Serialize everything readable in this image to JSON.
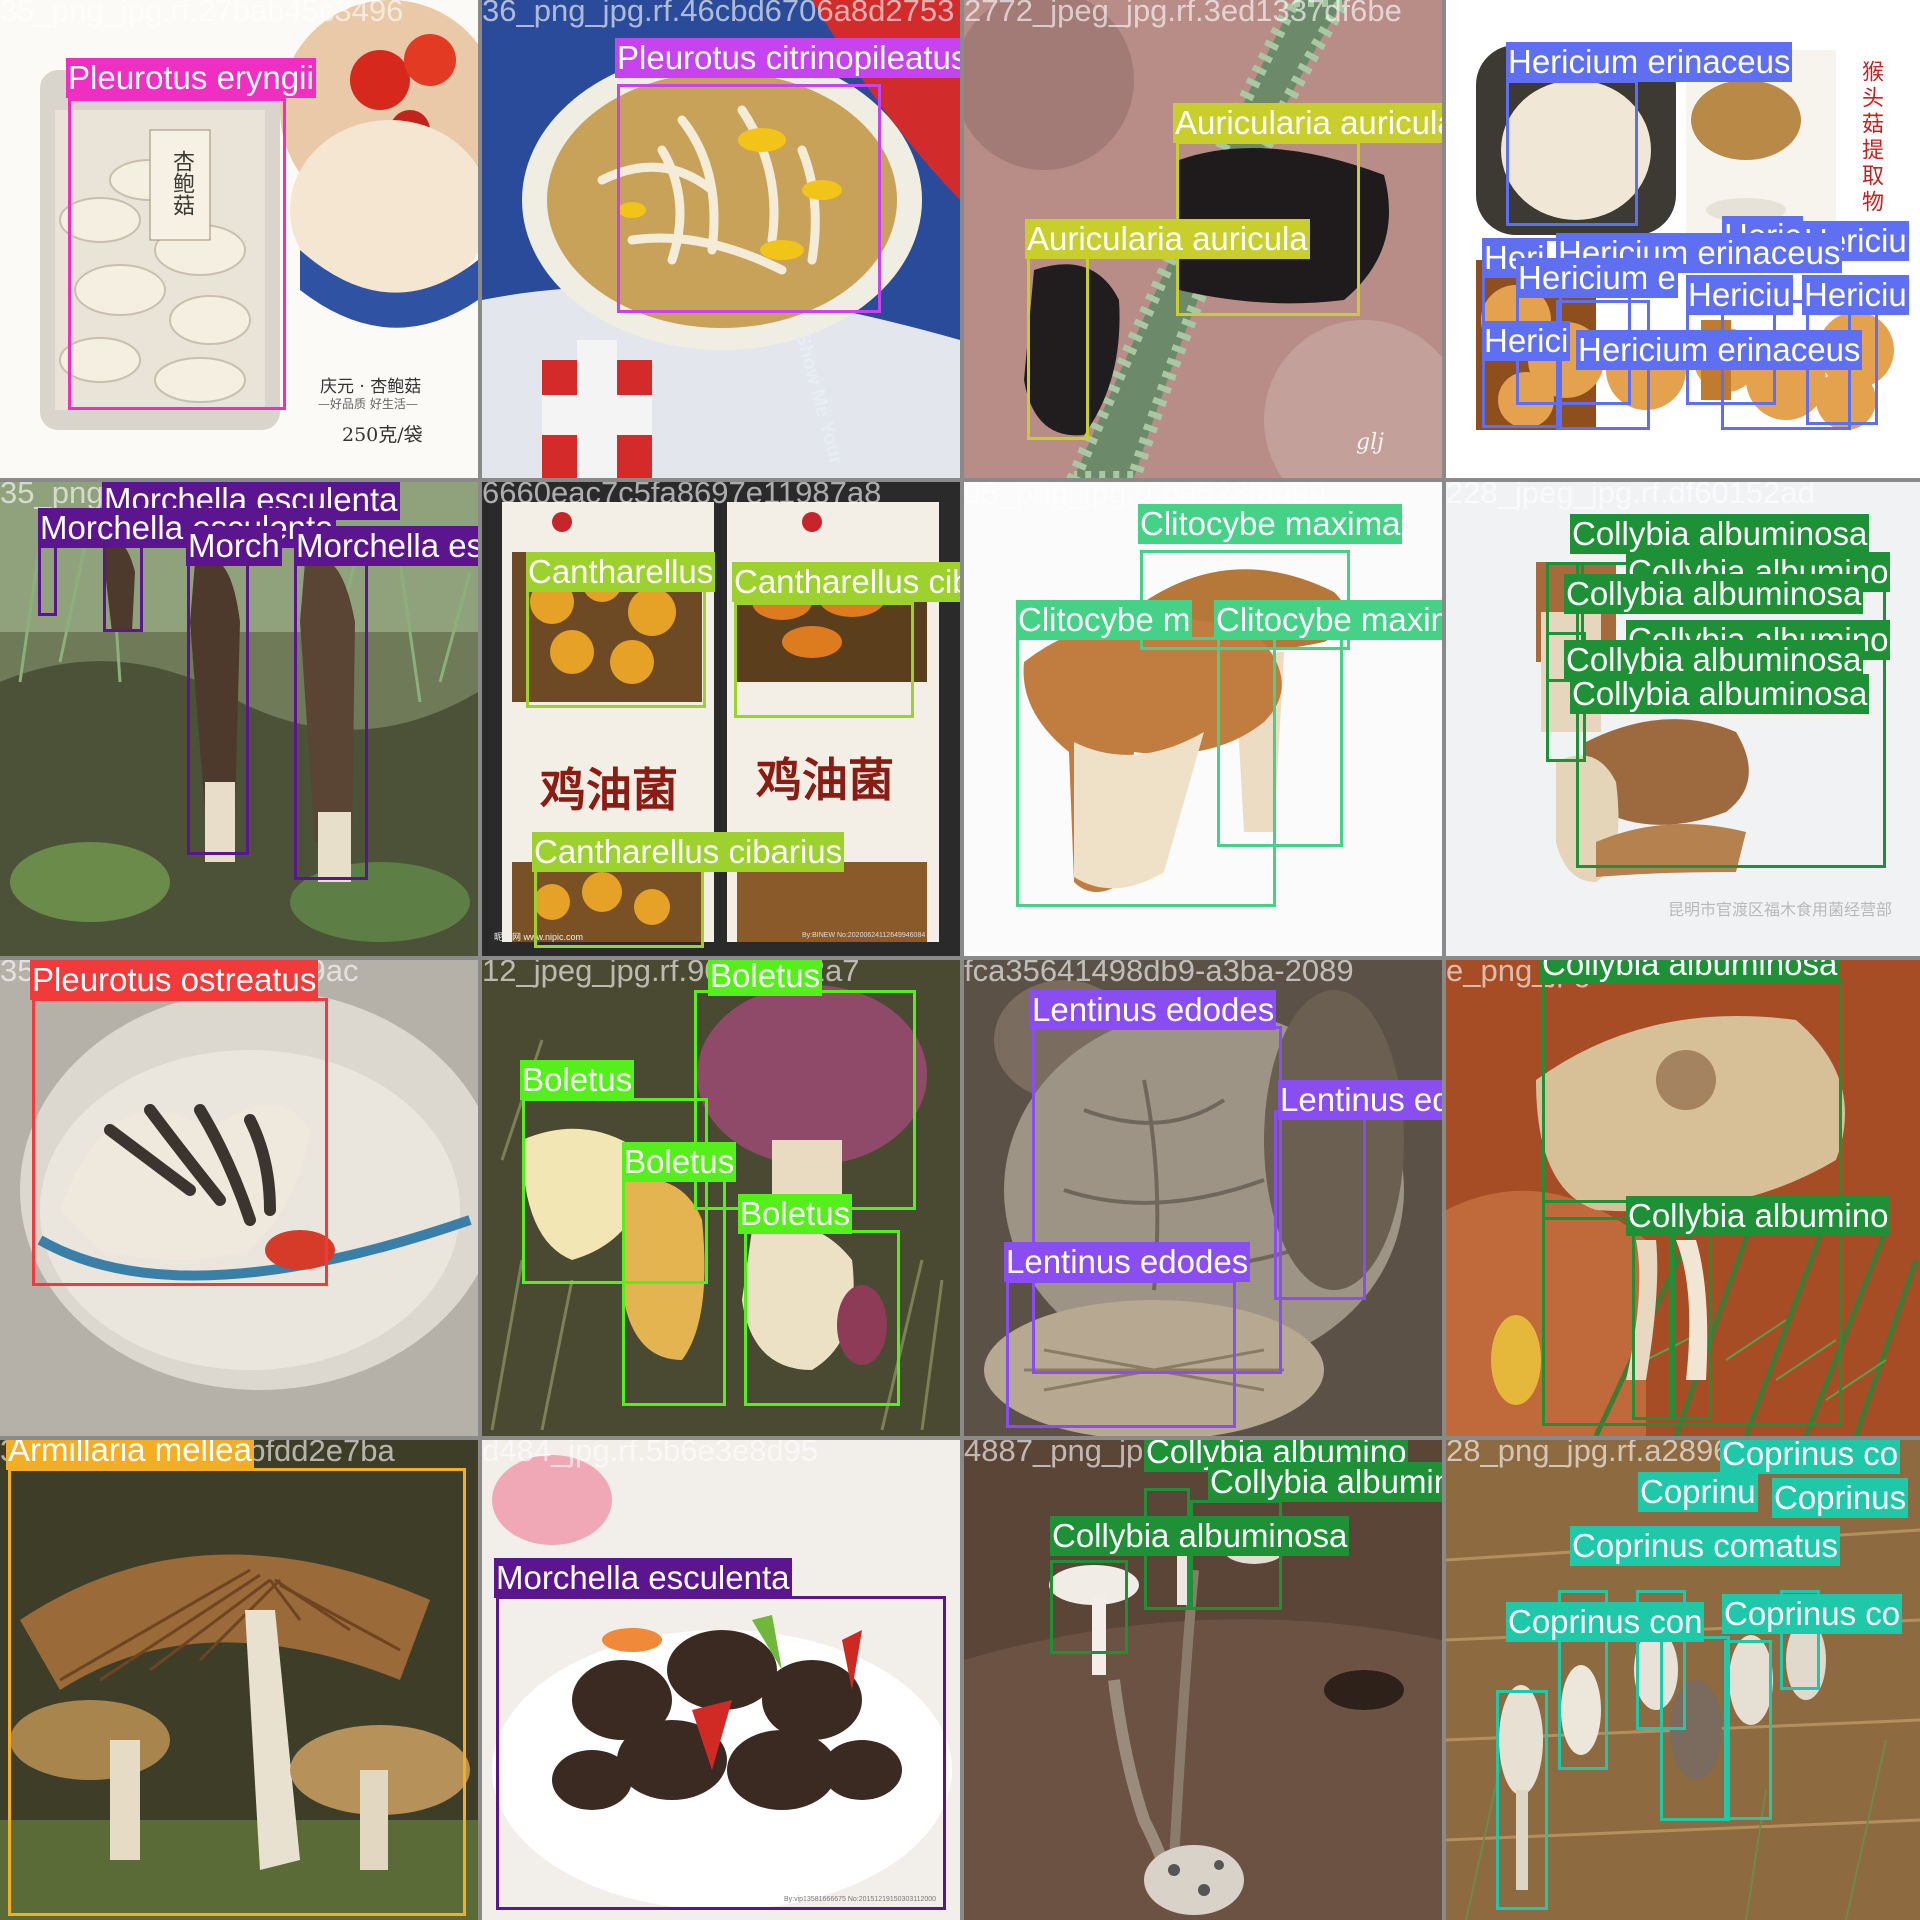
{
  "colors": {
    "Pleurotus eryngii": "#f02fc2",
    "Pleurotus citrinopileatus": "#c743f0",
    "Auricularia auricula": "#c8cf2c",
    "Hericium erinaceus": "#5f6ff2",
    "Morchella esculenta": "#5b168f",
    "Cantharellus cibarius": "#9cd12e",
    "Clitocybe maxima": "#45d286",
    "Collybia albuminosa": "#1e9136",
    "Pleurotus ostreatus": "#f23a3a",
    "Boletus": "#55f01c",
    "Lentinus edodes": "#8a4df2",
    "Armillaria mellea": "#f5ae24",
    "Coprinus comatus": "#1ec8a8"
  },
  "tiles": [
    {
      "filename": "35_png_jpg.rf.27bab45c3496",
      "labels": [
        "Pleurotus eryngii"
      ],
      "text": [
        "杏鲍菇",
        "庆元 · 杏鲍菇",
        "—好品质 好生活—",
        "250克/袋"
      ]
    },
    {
      "filename": "36_png_jpg.rf.46cbd6706a8d2753",
      "labels": [
        "Pleurotus citrinopileatus"
      ],
      "text": [
        "Show Me Your"
      ]
    },
    {
      "filename": "2772_jpeg_jpg.rf.3ed1337df6be",
      "labels": [
        "Auricularia auricula",
        "Auricularia auricula"
      ],
      "text": [
        "glj"
      ]
    },
    {
      "filename": "4336556c285cc21d124d55e",
      "labels": [
        "Hericium erinaceus",
        "Heric",
        "Hericiu",
        "Heri",
        "Hericium erinaceus",
        "Hericium e",
        "Hericiu",
        "Hericiu",
        "Herici",
        "Hericium erinaceus"
      ],
      "text": [
        "猴头菇提取物"
      ]
    },
    {
      "filename": "35_png_jpg.rf.2c06",
      "labels": [
        "Morchella esculenta",
        "Morchella esculenta",
        "Morch",
        "Morchella esculenta"
      ],
      "text": []
    },
    {
      "filename": "6660eac7c5fa8697e11987a8",
      "labels": [
        "Cantharellus",
        "Cantharellus cibarius",
        "Cantharellus cibarius"
      ],
      "text": [
        "鸡油菌",
        "鸡油菌",
        "昵图网 www.nipic.com",
        "By:BINEW No:20200624112649946084"
      ]
    },
    {
      "filename": "05_png_jpg.rf.ba523fa499",
      "labels": [
        "Clitocybe maxima",
        "Clitocybe m",
        "Clitocybe maxima"
      ],
      "text": []
    },
    {
      "filename": "228_jpeg_jpg.rf.df60152ad",
      "labels": [
        "Collybia albuminosa",
        "Collybia albumino",
        "Collybia albuminosa",
        "Collybia albumino",
        "Collybia albuminosa",
        "Collybia albuminosa"
      ],
      "text": [
        "昆明市官渡区福木食用菌经营部"
      ]
    },
    {
      "filename": "35_png_jpg.rf.a25cbf69ac",
      "labels": [
        "Pleurotus ostreatus"
      ],
      "text": []
    },
    {
      "filename": "12_jpeg_jpg.rf.905bb142a7",
      "labels": [
        "Boletus",
        "Boletus",
        "Boletus",
        "Boletus"
      ],
      "text": []
    },
    {
      "filename": "fca35641498db9-a3ba-2089",
      "labels": [
        "Lentinus edodes",
        "Lentinus edodes",
        "Lentinus edodes"
      ],
      "text": []
    },
    {
      "filename": "e_png_jpg.rf.9c0c833d",
      "labels": [
        "Collybia albuminosa",
        "Collybia albumino"
      ],
      "text": []
    },
    {
      "filename": "36_png_jpg.rf.bc7bfdd2e7ba",
      "labels": [
        "Armillaria mellea"
      ],
      "text": []
    },
    {
      "filename": "d484_jpg.rf.5b6e3e8d95",
      "labels": [
        "Morchella esculenta"
      ],
      "text": [
        "By:vip13581666675 No:20151219150303112000"
      ]
    },
    {
      "filename": "4887_png_jpg.rf.e1",
      "labels": [
        "Collybia albumino",
        "Collybia albuminosa",
        "Collybia albuminosa"
      ],
      "text": []
    },
    {
      "filename": "28_png_jpg.rf.a2896",
      "labels": [
        "Coprinus co",
        "Coprinu",
        "Coprinus",
        "Coprinus comatus",
        "Coprinus con",
        "Coprinus co"
      ],
      "text": []
    }
  ]
}
